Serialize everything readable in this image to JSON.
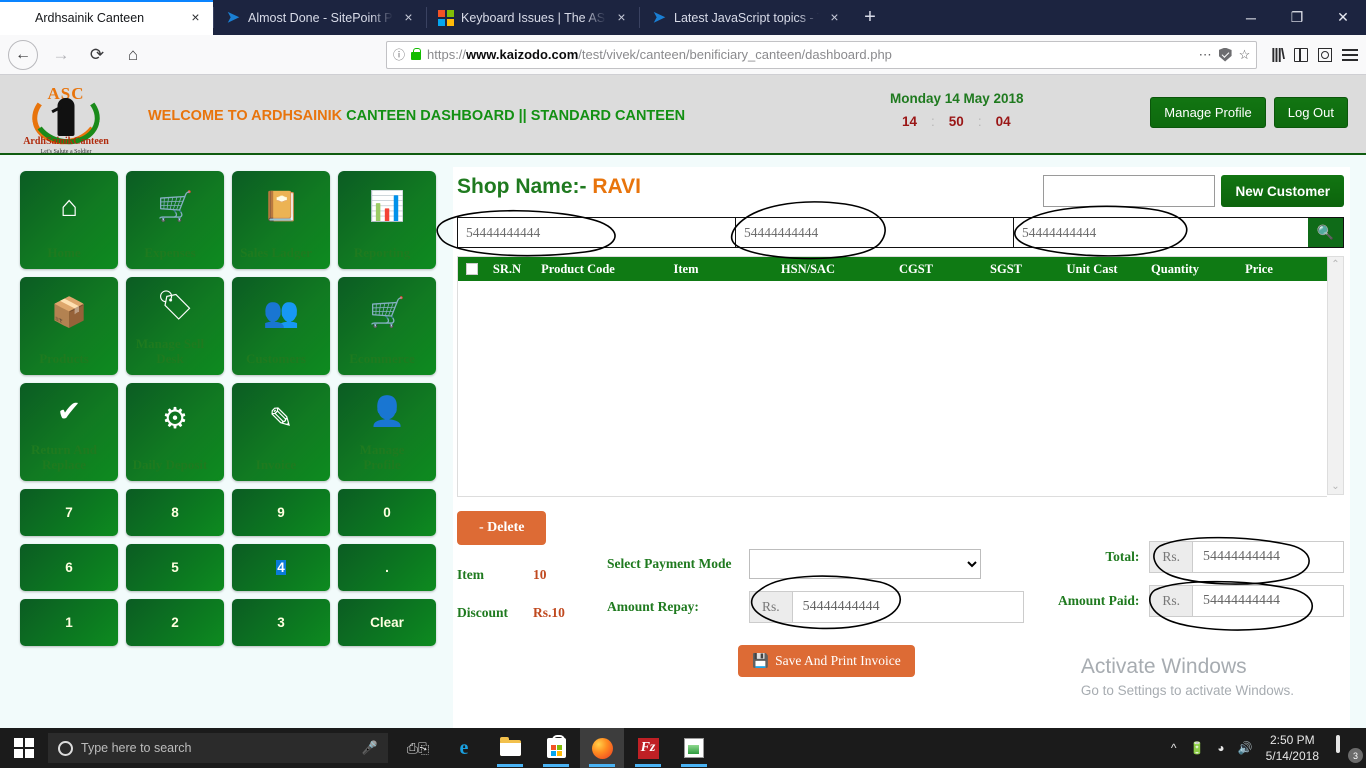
{
  "browser": {
    "tabs": [
      {
        "title": "Ardhsainik Canteen",
        "active": true,
        "icon": "none"
      },
      {
        "title": "Almost Done - SitePoint Premiu",
        "active": false,
        "icon": "sitepoint-icon"
      },
      {
        "title": "Keyboard Issues | The ASP.NET",
        "active": false,
        "icon": "microsoft-icon"
      },
      {
        "title": "Latest JavaScript topics - The Si",
        "active": false,
        "icon": "sitepoint-icon"
      }
    ],
    "close_label": "×",
    "newtab_label": "+",
    "window_controls": {
      "minimize": "─",
      "maximize": "❐",
      "close": "✕"
    },
    "url_domain": "www.kaizodo.com",
    "url_prefix": "https://",
    "url_path": "/test/vivek/canteen/benificiary_canteen/dashboard.php",
    "nav": {
      "back": "←",
      "forward": "→",
      "reload": "⟳",
      "home": "⌂"
    }
  },
  "app": {
    "logo": {
      "initials": "ASC",
      "name": "ArdhSainikCanteen",
      "tagline": "Let's Salute a Soldier"
    },
    "welcome_orange": "WELCOME TO ARDHSAINIK",
    "welcome_green": "CANTEEN DASHBOARD || STANDARD CANTEEN",
    "date": "Monday 14 May 2018",
    "clock": {
      "hours": "14",
      "minutes": "50",
      "seconds": "04",
      "separator": ":"
    },
    "manage_profile_label": "Manage Profile",
    "logout_label": "Log Out"
  },
  "sidebar": {
    "tiles": [
      {
        "label": "Home",
        "icon": "home-icon",
        "glyph": "⌂"
      },
      {
        "label": "Expenses",
        "icon": "cart-up-icon",
        "glyph": "⇧"
      },
      {
        "label": "Sales Ladger",
        "icon": "book-icon",
        "glyph": "▤"
      },
      {
        "label": "Reporting",
        "icon": "report-chart-icon",
        "glyph": "▥"
      },
      {
        "label": "Products",
        "icon": "box-icon",
        "glyph": "⬒"
      },
      {
        "label": "Manage Sell Desk",
        "icon": "tag-icon",
        "glyph": "⚑"
      },
      {
        "label": "Customers",
        "icon": "people-icon",
        "glyph": "☻"
      },
      {
        "label": "Ecommerce",
        "icon": "shopping-cart-icon",
        "glyph": "⛟"
      },
      {
        "label": "Return And Replace",
        "icon": "check-circle-icon",
        "glyph": "✔"
      },
      {
        "label": "Daily Deposit",
        "icon": "deposit-icon",
        "glyph": "☷"
      },
      {
        "label": "Invoice",
        "icon": "edit-square-icon",
        "glyph": "✎"
      },
      {
        "label": "Manage Profile",
        "icon": "user-badge-icon",
        "glyph": "⛃"
      }
    ],
    "keys": [
      {
        "label": "7",
        "selected": false
      },
      {
        "label": "8",
        "selected": false
      },
      {
        "label": "9",
        "selected": false
      },
      {
        "label": "0",
        "selected": false
      },
      {
        "label": "6",
        "selected": false
      },
      {
        "label": "5",
        "selected": false
      },
      {
        "label": "4",
        "selected": true
      },
      {
        "label": ".",
        "selected": false
      },
      {
        "label": "1",
        "selected": false
      },
      {
        "label": "2",
        "selected": false
      },
      {
        "label": "3",
        "selected": false
      },
      {
        "label": "Clear",
        "selected": false
      }
    ]
  },
  "main": {
    "shop_label": "Shop Name:-",
    "shop_value": "RAVI",
    "customer_input_value": "",
    "new_customer_label": "New Customer",
    "search_fields": [
      {
        "value": "54444444444"
      },
      {
        "value": "54444444444"
      },
      {
        "value": "54444444444"
      }
    ],
    "search_icon": "search-icon",
    "table": {
      "columns": [
        "SR.N",
        "Product Code",
        "Item",
        "HSN/SAC",
        "CGST",
        "SGST",
        "Unit Cast",
        "Quantity",
        "Price"
      ],
      "rows": []
    },
    "scroll": {
      "up": "⌃",
      "down": "⌄"
    },
    "delete_label": "- Delete",
    "summary": [
      {
        "key": "Item",
        "value": "10"
      },
      {
        "key": "Discount",
        "value": "Rs.10"
      }
    ],
    "payment_mode_label": "Select Payment Mode",
    "payment_mode_value": "",
    "payment_mode_options": [
      ""
    ],
    "amount_repay_label": "Amount Repay:",
    "amount_repay_prefix": "Rs.",
    "amount_repay_value": "54444444444",
    "total_label": "Total:",
    "total_prefix": "Rs.",
    "total_value": "54444444444",
    "amount_paid_label": "Amount Paid:",
    "amount_paid_prefix": "Rs.",
    "amount_paid_value": "54444444444",
    "save_label": "Save And Print Invoice",
    "save_icon": "save-icon"
  },
  "watermark": {
    "line1": "Activate Windows",
    "line2": "Go to Settings to activate Windows."
  },
  "taskbar": {
    "search_placeholder": "Type here to search",
    "icons": [
      "task-view-icon",
      "edge-icon",
      "file-explorer-icon",
      "microsoft-store-icon",
      "firefox-icon",
      "filezilla-icon",
      "notepad-plus-icon"
    ],
    "time": "2:50 PM",
    "date": "5/14/2018",
    "notification_count": "3"
  },
  "colors": {
    "green": "#0f7a14",
    "dark_green": "#0b5c23",
    "orange": "#e8740c",
    "delete_orange": "#dd6b35",
    "red": "#9a1616",
    "tab_bar": "#1c2440"
  }
}
